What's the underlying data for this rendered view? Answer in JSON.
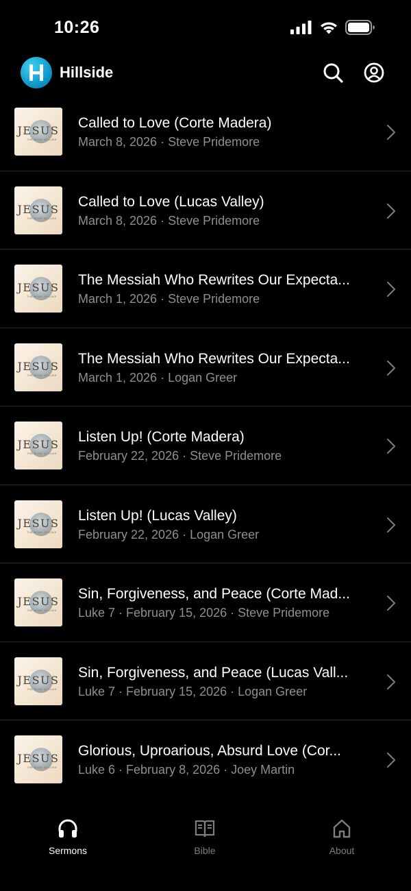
{
  "status": {
    "time": "10:26"
  },
  "header": {
    "app_name": "Hillside",
    "logo_letter": "H"
  },
  "thumbnail": {
    "word": "JESUS",
    "caption": "THE BOOK OF LUKE"
  },
  "sermons": [
    {
      "title": "Called to Love (Corte Madera)",
      "meta": "March 8, 2026 · Steve Pridemore"
    },
    {
      "title": "Called to Love (Lucas Valley)",
      "meta": "March 8, 2026 · Steve Pridemore"
    },
    {
      "title": "The Messiah Who Rewrites Our Expecta...",
      "meta": "March 1, 2026 · Steve Pridemore"
    },
    {
      "title": "The Messiah Who Rewrites Our Expecta...",
      "meta": "March 1, 2026 · Logan Greer"
    },
    {
      "title": "Listen Up! (Corte Madera)",
      "meta": "February 22, 2026 · Steve Pridemore"
    },
    {
      "title": "Listen Up! (Lucas Valley)",
      "meta": "February 22, 2026 · Logan Greer"
    },
    {
      "title": "Sin, Forgiveness, and Peace (Corte Mad...",
      "meta": "Luke 7 · February 15, 2026 · Steve Pridemore"
    },
    {
      "title": "Sin, Forgiveness, and Peace (Lucas Vall...",
      "meta": "Luke 7 · February 15, 2026 · Logan Greer"
    },
    {
      "title": "Glorious, Uproarious, Absurd Love (Cor...",
      "meta": "Luke 6 · February 8, 2026 · Joey Martin"
    }
  ],
  "tabs": [
    {
      "label": "Sermons",
      "icon": "headphones-icon",
      "active": true
    },
    {
      "label": "Bible",
      "icon": "book-icon",
      "active": false
    },
    {
      "label": "About",
      "icon": "home-icon",
      "active": false
    }
  ],
  "colors": {
    "background": "#000000",
    "secondary_text": "#8e8e93",
    "separator": "#2a2a2c",
    "logo": "#0b8fc4"
  }
}
